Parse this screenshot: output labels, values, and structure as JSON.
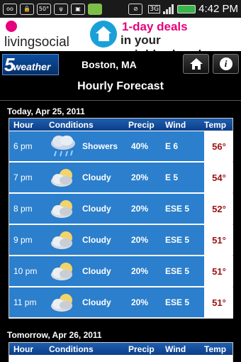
{
  "status_bar": {
    "time": "4:42 PM",
    "icons": [
      "voicemail-icon",
      "lock-icon",
      "temp-icon",
      "usb-icon",
      "bag-icon",
      "android-icon",
      "no-sim-icon",
      "3g-icon",
      "signal-icon",
      "battery-icon"
    ],
    "temp_label": "50°",
    "network_label": "3G"
  },
  "ad": {
    "brand": "livingsocial",
    "line1": "1-day deals",
    "line2": "in your neighborhood",
    "colors": {
      "pink": "#e6007e",
      "blue": "#1aa0d8"
    }
  },
  "header": {
    "logo_number": "5",
    "logo_text": "weather",
    "city": "Boston, MA",
    "home_icon": "home-icon",
    "info_label": "i"
  },
  "title": "Hourly Forecast",
  "columns": [
    "Hour",
    "Conditions",
    "Precip",
    "Wind",
    "Temp"
  ],
  "days": [
    {
      "label": "Today, Apr 25, 2011",
      "rows": [
        {
          "hour": "6 pm",
          "icon": "rain-cloud-icon",
          "condition": "Showers",
          "precip": "40%",
          "wind": "E 6",
          "temp": "56°"
        },
        {
          "hour": "7 pm",
          "icon": "cloudy-icon",
          "condition": "Cloudy",
          "precip": "20%",
          "wind": "E 5",
          "temp": "54°"
        },
        {
          "hour": "8 pm",
          "icon": "cloudy-icon",
          "condition": "Cloudy",
          "precip": "20%",
          "wind": "ESE 5",
          "temp": "52°"
        },
        {
          "hour": "9 pm",
          "icon": "cloudy-icon",
          "condition": "Cloudy",
          "precip": "20%",
          "wind": "ESE 5",
          "temp": "51°"
        },
        {
          "hour": "10 pm",
          "icon": "cloudy-icon",
          "condition": "Cloudy",
          "precip": "20%",
          "wind": "ESE 5",
          "temp": "51°"
        },
        {
          "hour": "11 pm",
          "icon": "cloudy-icon",
          "condition": "Cloudy",
          "precip": "20%",
          "wind": "ESE 5",
          "temp": "51°"
        }
      ]
    },
    {
      "label": "Tomorrow, Apr 26, 2011",
      "rows": []
    }
  ]
}
